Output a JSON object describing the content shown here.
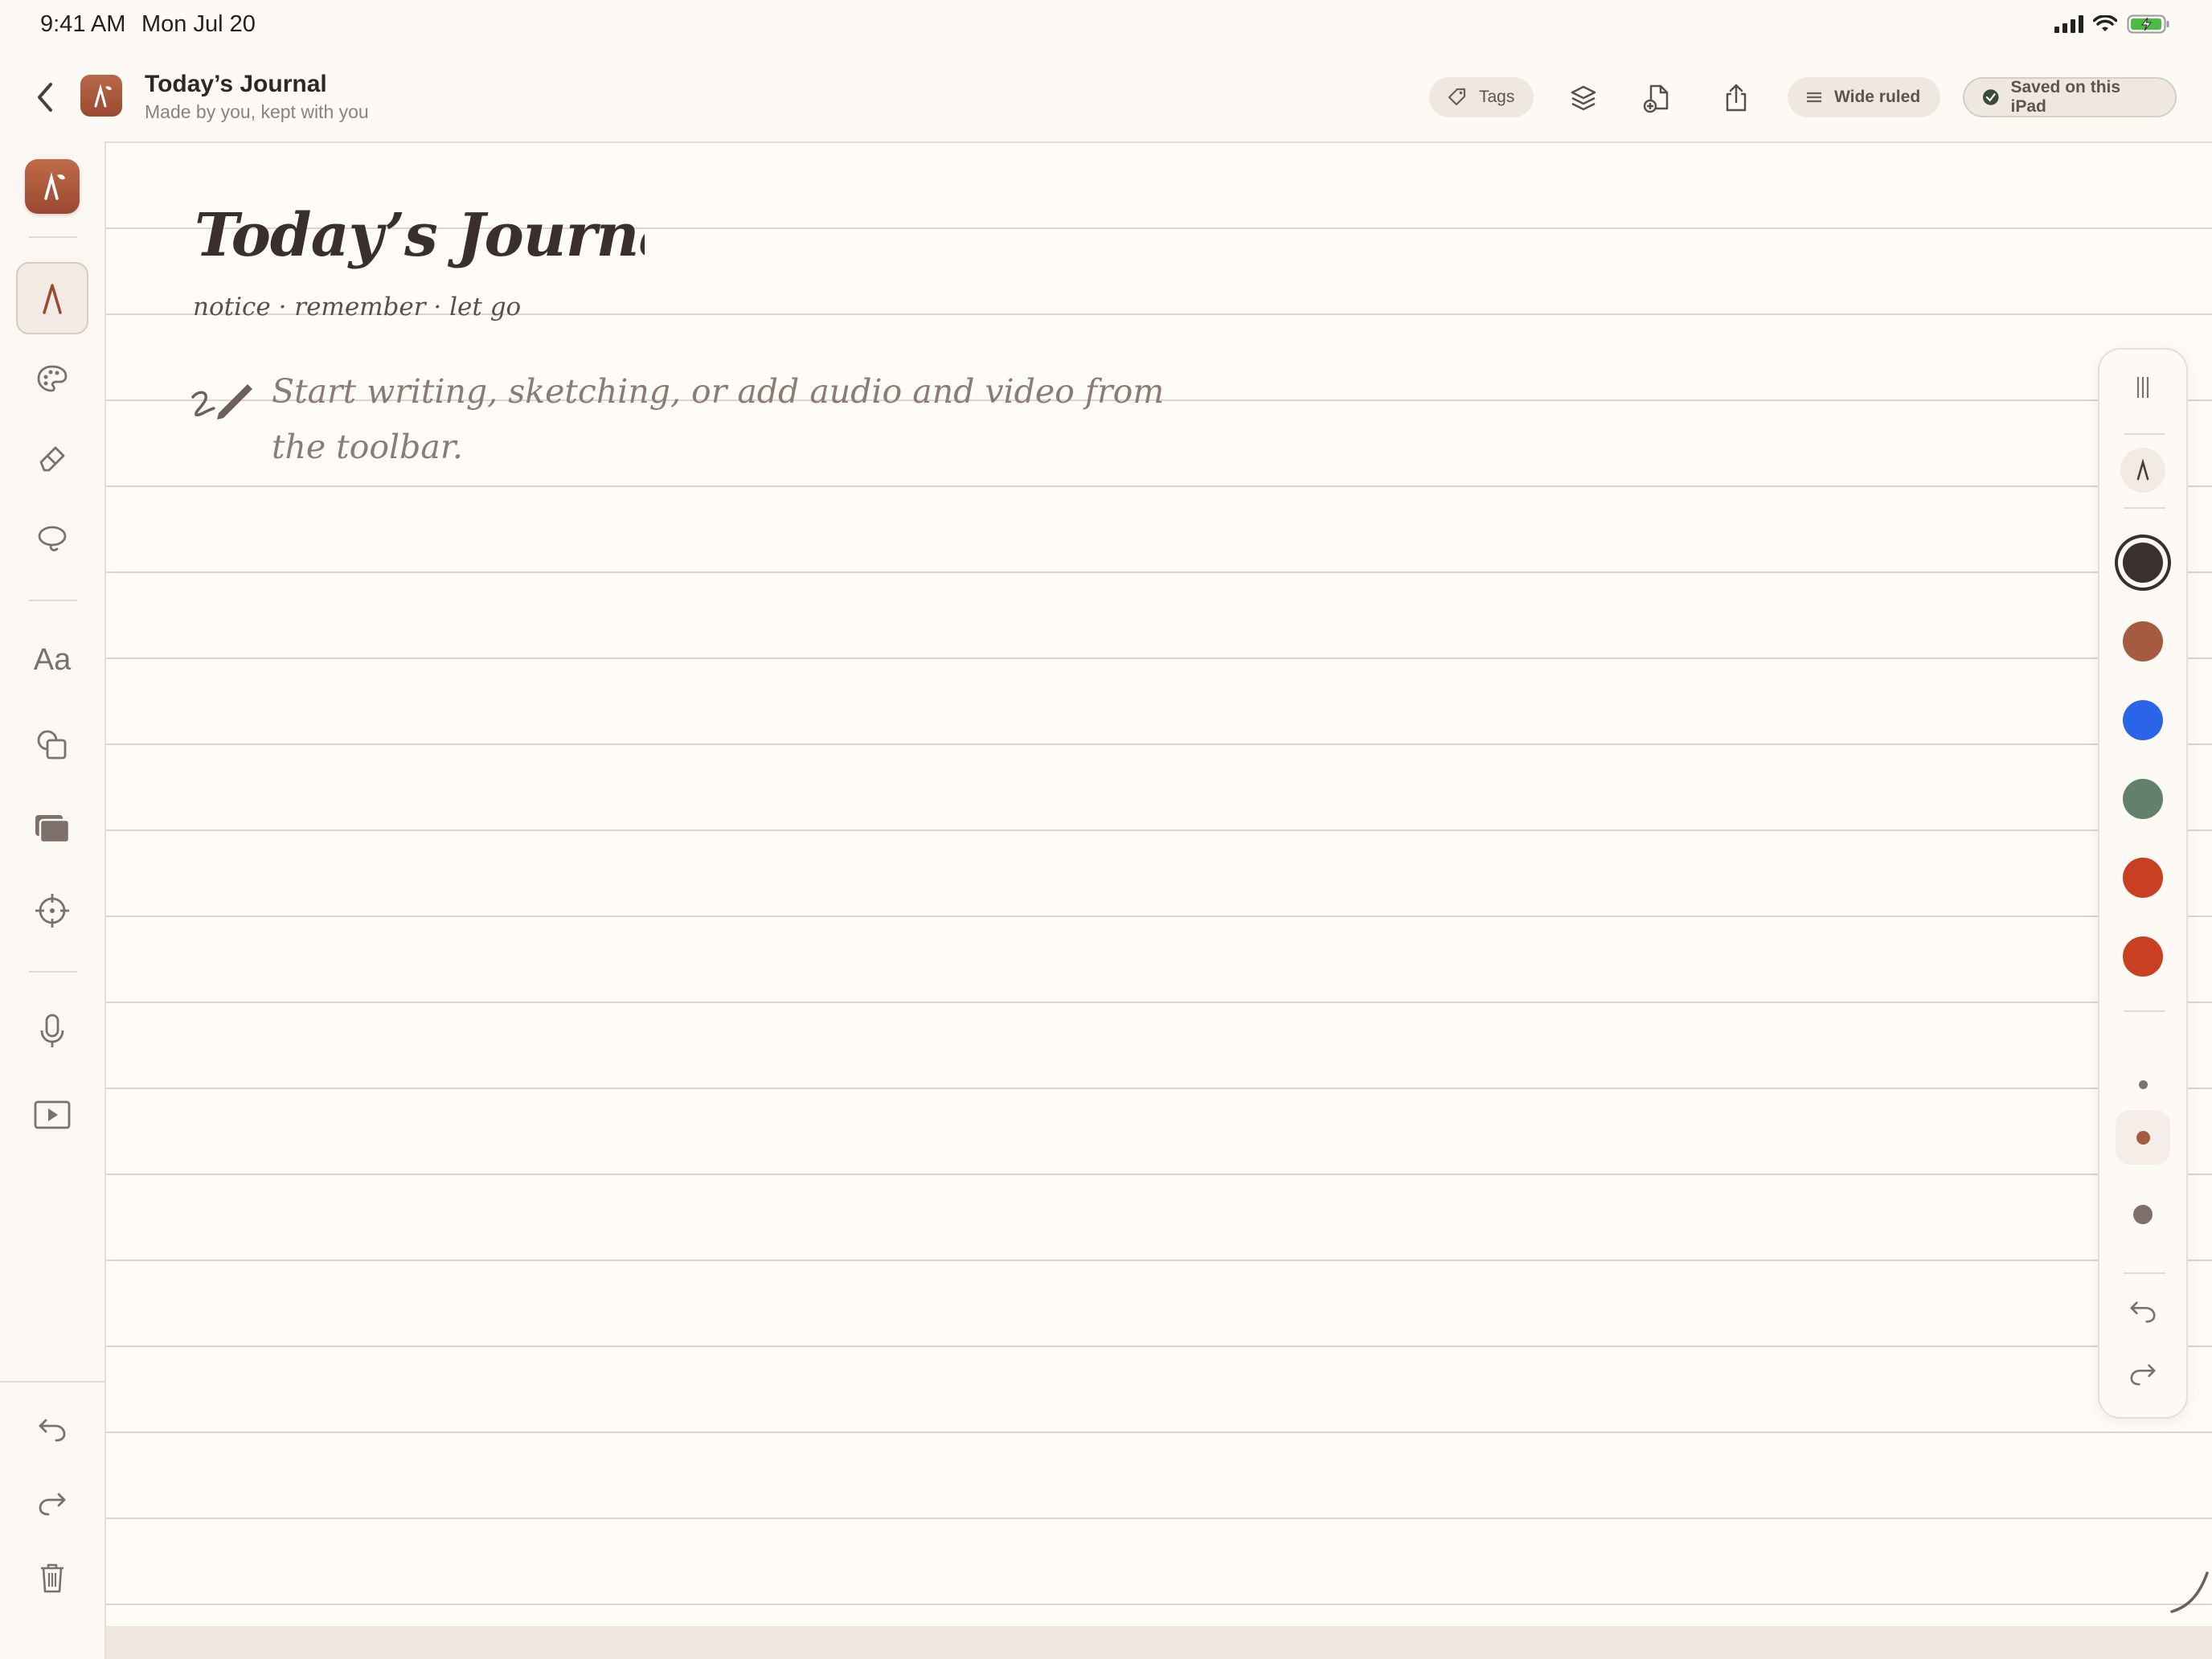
{
  "status_bar": {
    "time": "9:41 AM",
    "date": "Mon Jul 20"
  },
  "header": {
    "back_icon": "chevron-left-icon",
    "title": "Today’s Journal",
    "subtitle": "Made by you, kept with you",
    "tags_label": "Tags",
    "paper_label": "Wide ruled",
    "saved_label": "Saved on this iPad"
  },
  "sidebar": {
    "tools": [
      "pen-tool",
      "palette-tool",
      "eraser-tool",
      "lasso-tool",
      "text-tool",
      "shapes-tool",
      "media-tool",
      "target-tool",
      "microphone-tool",
      "video-tool"
    ],
    "text_tool_label": "Aa",
    "actions": [
      "undo",
      "redo",
      "trash"
    ]
  },
  "page": {
    "title": "Today’s Journal",
    "tagline": "notice · remember · let go",
    "prompt": "Start writing, sketching, or add audio and video from the toolbar."
  },
  "palette": {
    "colors": [
      "#3b302d",
      "#a65a40",
      "#2a64e8",
      "#62806a",
      "#c83f22",
      "#c83f22"
    ],
    "selected_color_index": 0,
    "sizes": [
      "small",
      "medium",
      "large"
    ],
    "selected_size_index": 1
  }
}
